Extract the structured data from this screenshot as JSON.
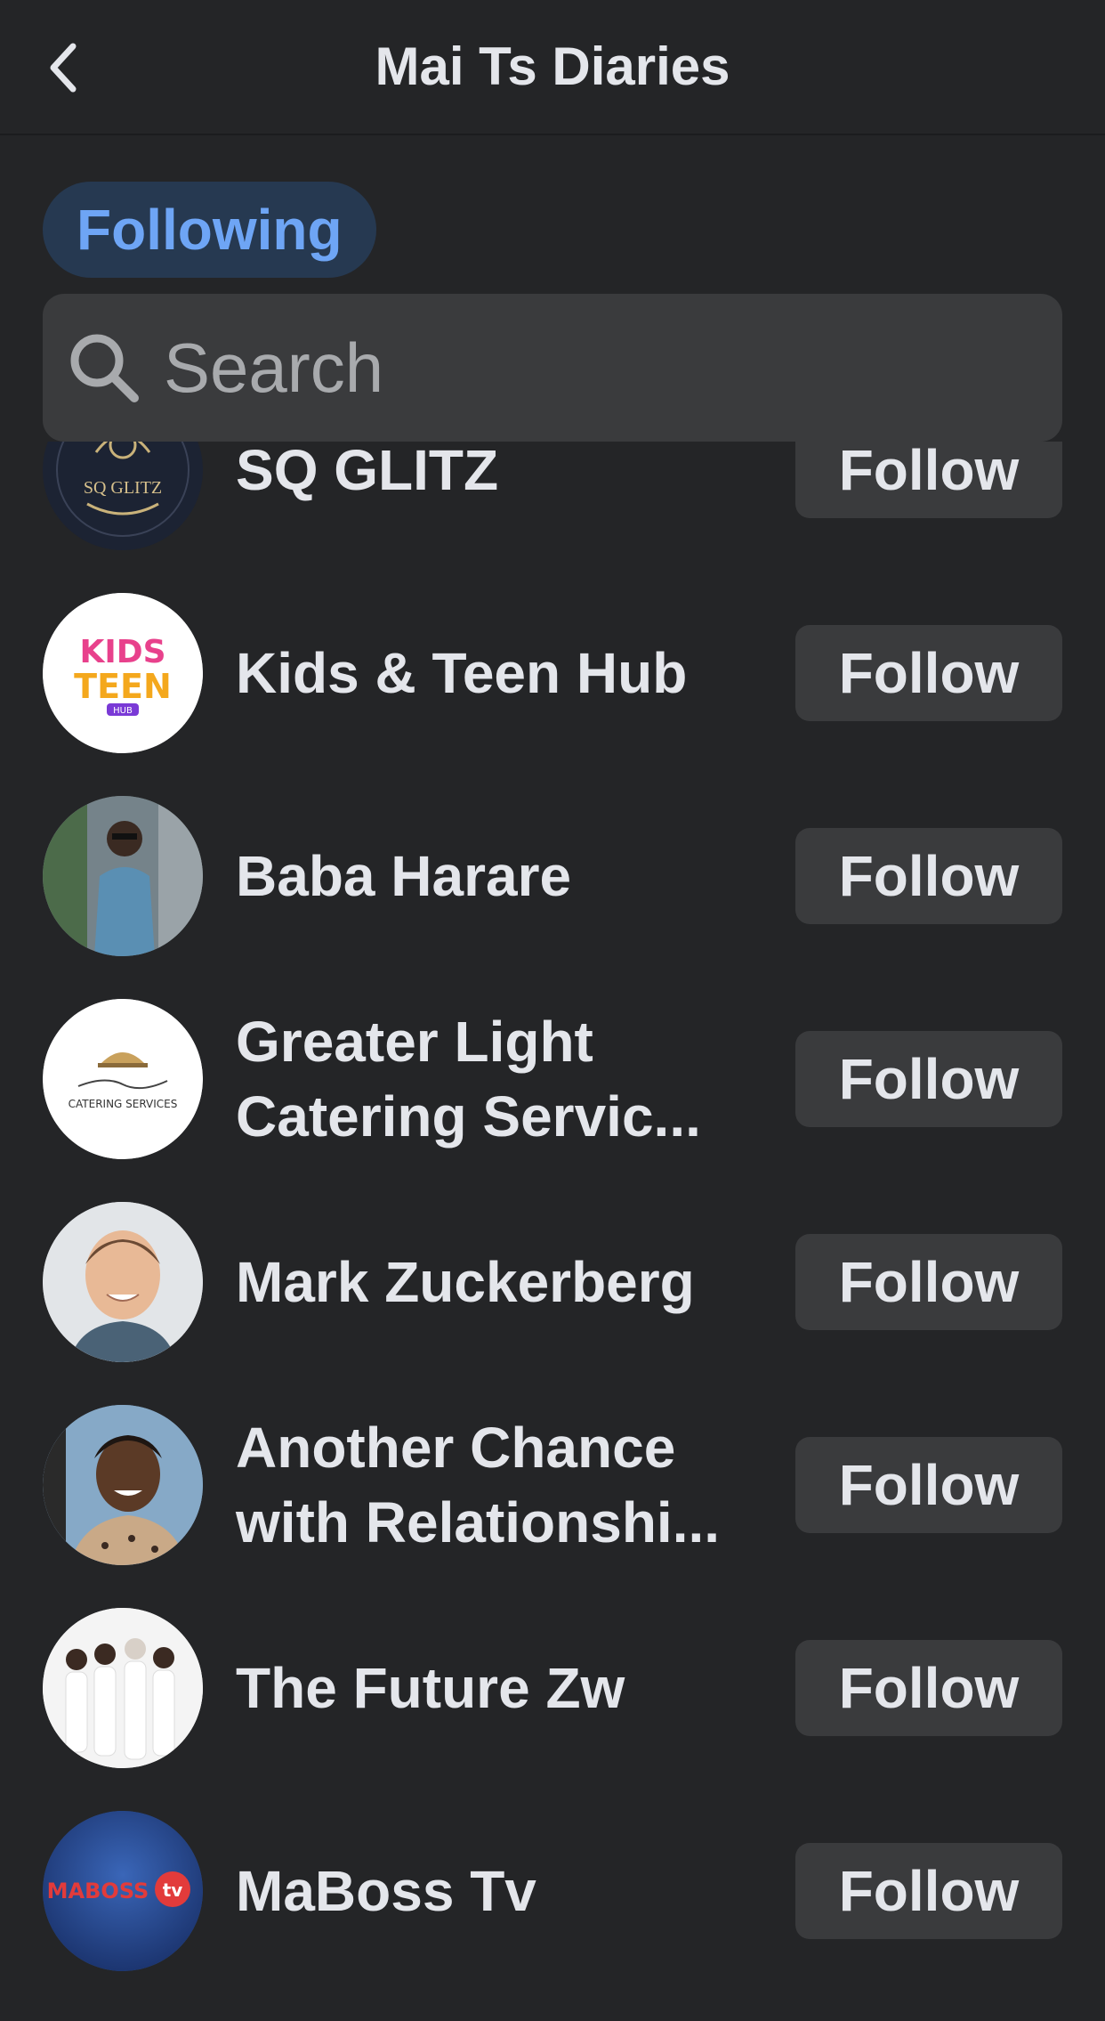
{
  "header": {
    "title": "Mai Ts Diaries",
    "back_icon": "chevron-left-icon"
  },
  "filter": {
    "chip_label": "Following"
  },
  "search": {
    "placeholder": "Search",
    "value": "",
    "icon": "search-icon"
  },
  "list": {
    "items": [
      {
        "name": "SQ GLITZ",
        "name_line2": "",
        "button": "Follow",
        "avatar": "sq-glitz-logo",
        "logo_text": "SQ GLITZ"
      },
      {
        "name": "Kids & Teen Hub",
        "name_line2": "",
        "button": "Follow",
        "avatar": "kids-teen-hub-logo",
        "logo_text": "KIDS & TEEN"
      },
      {
        "name": "Baba Harare",
        "name_line2": "",
        "button": "Follow",
        "avatar": "person-photo"
      },
      {
        "name": "Greater Light",
        "name_line2": "Catering Servic...",
        "button": "Follow",
        "avatar": "greater-light-logo",
        "logo_text": "CATERING SERVICES"
      },
      {
        "name": "Mark Zuckerberg",
        "name_line2": "",
        "button": "Follow",
        "avatar": "person-photo"
      },
      {
        "name": "Another Chance",
        "name_line2": "with Relationshi...",
        "button": "Follow",
        "avatar": "person-photo"
      },
      {
        "name": "The Future Zw",
        "name_line2": "",
        "button": "Follow",
        "avatar": "group-photo"
      },
      {
        "name": "MaBoss Tv",
        "name_line2": "",
        "button": "Follow",
        "avatar": "maboss-tv-logo",
        "logo_text": "MABOSS tv"
      }
    ]
  },
  "colors": {
    "background": "#242527",
    "chip_bg": "#263951",
    "chip_text": "#6ea5f5",
    "button_bg": "#3a3b3d",
    "text": "#e4e6eb"
  }
}
